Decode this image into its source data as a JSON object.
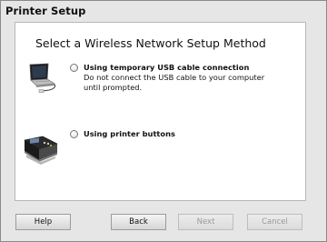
{
  "window": {
    "title": "Printer Setup"
  },
  "main": {
    "heading": "Select a Wireless Network Setup Method",
    "options": [
      {
        "label": "Using temporary USB cable connection",
        "description_line1": "Do not connect the USB cable to your computer",
        "description_line2": "until prompted.",
        "selected": false,
        "icon": "laptop-usb-icon"
      },
      {
        "label": "Using printer buttons",
        "selected": false,
        "icon": "printer-panel-icon"
      }
    ]
  },
  "footer": {
    "help": "Help",
    "back": "Back",
    "next": "Next",
    "cancel": "Cancel"
  }
}
